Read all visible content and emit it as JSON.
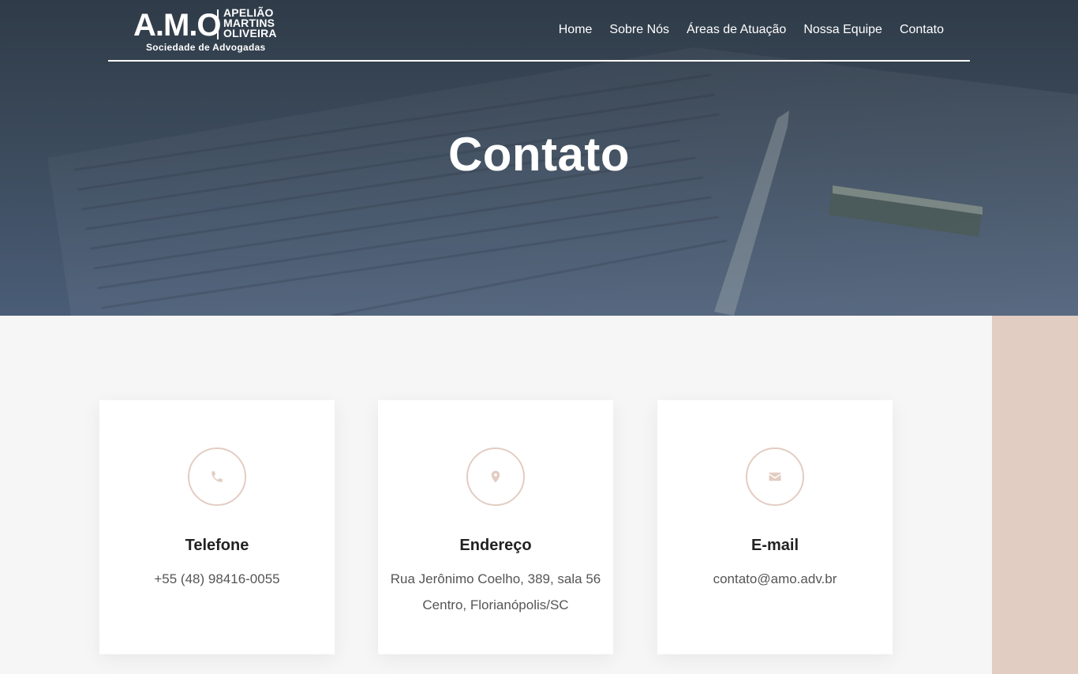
{
  "brand": {
    "mark": "A.M.O",
    "names": [
      "APELIÃO",
      "MARTINS",
      "OLIVEIRA"
    ],
    "subtitle": "Sociedade de Advogadas"
  },
  "nav": {
    "items": [
      {
        "label": "Home"
      },
      {
        "label": "Sobre Nós"
      },
      {
        "label": "Áreas de Atuação"
      },
      {
        "label": "Nossa Equipe"
      },
      {
        "label": "Contato"
      }
    ]
  },
  "hero": {
    "title": "Contato"
  },
  "cards": [
    {
      "title": "Telefone",
      "icon": "phone-icon",
      "lines": [
        "+55 (48) 98416-0055"
      ]
    },
    {
      "title": "Endereço",
      "icon": "map-pin-icon",
      "lines": [
        "Rua Jerônimo Coelho, 389, sala 56",
        "Centro, Florianópolis/SC"
      ]
    },
    {
      "title": "E-mail",
      "icon": "envelope-icon",
      "lines": [
        "contato@amo.adv.br"
      ]
    }
  ],
  "colors": {
    "accent": "#e2cdc2",
    "hero_dark": "#2f3b48",
    "hero_light": "#4a5d77",
    "background": "#f6f6f6",
    "heading": "#222222",
    "text": "#555555"
  }
}
